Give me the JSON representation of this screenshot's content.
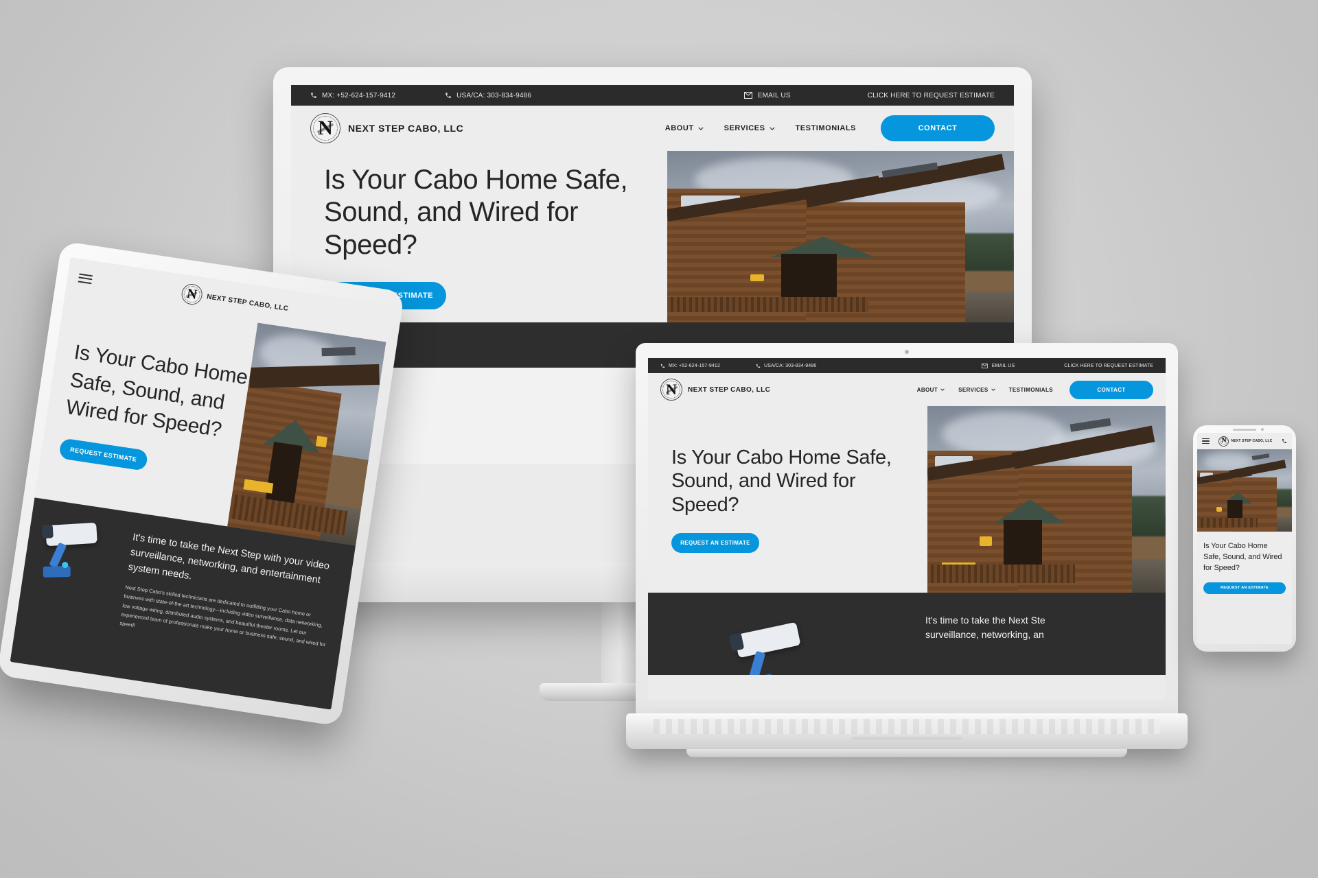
{
  "site": {
    "topbar": {
      "phone_mx_label": "MX: +52-624-157-9412",
      "phone_us_label": "USA/CA: 303-834-9486",
      "email_label": "EMAIL US",
      "estimate_label": "CLICK HERE TO REQUEST ESTIMATE",
      "bg_color": "#2b2b2b"
    },
    "nav": {
      "logo_letter": "N",
      "brand": "NEXT STEP CABO, LLC",
      "items": [
        {
          "label": "ABOUT",
          "has_dropdown": true
        },
        {
          "label": "SERVICES",
          "has_dropdown": true
        },
        {
          "label": "TESTIMONIALS",
          "has_dropdown": false
        }
      ],
      "contact_label": "CONTACT",
      "accent_color": "#0596dd"
    },
    "hero": {
      "heading_line1": "Is Your Cabo Home Safe,",
      "heading_line2": "Sound, and Wired for Speed?",
      "heading_tablet": "Is Your Cabo Home Safe, Sound, and Wired for Speed?",
      "cta_label": "REQUEST AN ESTIMATE",
      "cta_label_short": "REQUEST ESTIMATE"
    },
    "dark_section": {
      "heading": "It's time to take the Next Step with your video surveillance, networking, and entertainment system needs.",
      "heading_clip_line1": "It's time to take the Next Ste",
      "heading_clip_line2": "surveillance, networking, an",
      "paragraph": "Next Step Cabo's skilled technicians are dedicated to outfitting your Cabo home or business with state-of-the art technology—including video surveillance, data networking, low voltage wiring, distributed audio systems, and beautiful theater rooms. Let our experienced team of professionals make your home or business safe, sound, and wired for speed!",
      "bg_color": "#2e2e2e"
    }
  },
  "mockup": {
    "devices": [
      "desktop-monitor",
      "tablet",
      "laptop",
      "phone"
    ],
    "background_color": "#cfcfcf"
  }
}
